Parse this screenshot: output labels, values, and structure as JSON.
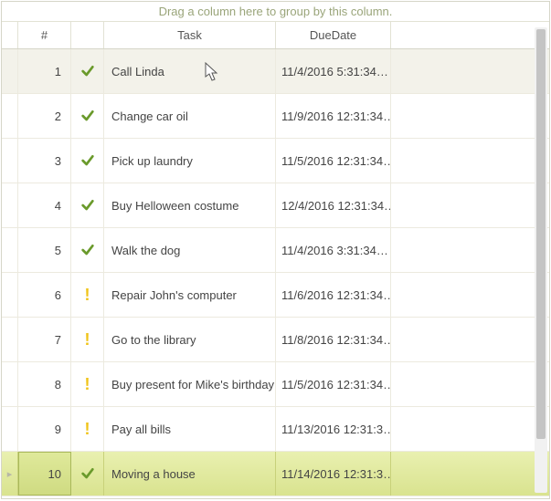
{
  "groupPanel": {
    "hint": "Drag a column here to group by this column."
  },
  "columns": {
    "num": "#",
    "status": "",
    "task": "Task",
    "due": "DueDate"
  },
  "rows": [
    {
      "n": "1",
      "status": "done",
      "task": "Call Linda",
      "due": "11/4/2016 5:31:34…",
      "state": "hover",
      "cursor": true
    },
    {
      "n": "2",
      "status": "done",
      "task": "Change car oil",
      "due": "11/9/2016 12:31:34…"
    },
    {
      "n": "3",
      "status": "done",
      "task": "Pick up laundry",
      "due": "11/5/2016 12:31:34…"
    },
    {
      "n": "4",
      "status": "done",
      "task": "Buy Helloween costume",
      "due": "12/4/2016 12:31:34…"
    },
    {
      "n": "5",
      "status": "done",
      "task": "Walk the dog",
      "due": "11/4/2016 3:31:34…"
    },
    {
      "n": "6",
      "status": "warn",
      "task": "Repair John's computer",
      "due": "11/6/2016 12:31:34…"
    },
    {
      "n": "7",
      "status": "warn",
      "task": "Go to the library",
      "due": "11/8/2016 12:31:34…"
    },
    {
      "n": "8",
      "status": "warn",
      "task": "Buy present for Mike's birthday",
      "due": "11/5/2016 12:31:34…"
    },
    {
      "n": "9",
      "status": "warn",
      "task": "Pay all bills",
      "due": "11/13/2016 12:31:3…"
    },
    {
      "n": "10",
      "status": "done",
      "task": "Moving a house",
      "due": "11/14/2016 12:31:3…",
      "state": "active",
      "indicator": true
    }
  ]
}
